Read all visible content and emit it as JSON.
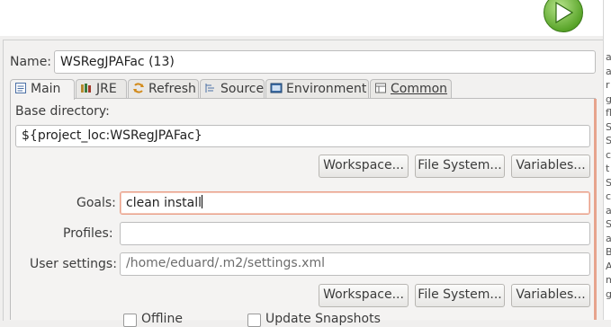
{
  "toolbar": {
    "run_icon": "play-icon"
  },
  "doc_margin": [
    "a",
    "a",
    "r",
    "g",
    "fl",
    "S",
    "S",
    "c",
    "t",
    "S",
    "c",
    "a",
    "S",
    "a",
    "B",
    "A",
    "m",
    "g"
  ],
  "dialog": {
    "name_label": "Name:",
    "name_value": "WSRegJPAFac (13)",
    "tabs": [
      {
        "label": "Main",
        "icon": "main-tab-icon"
      },
      {
        "label": "JRE",
        "icon": "jre-icon"
      },
      {
        "label": "Refresh",
        "icon": "refresh-icon"
      },
      {
        "label": "Source",
        "icon": "source-icon"
      },
      {
        "label": "Environment",
        "icon": "environment-icon"
      },
      {
        "label": "Common",
        "icon": "common-icon"
      }
    ],
    "main": {
      "base_dir_label": "Base directory:",
      "base_dir_value": "${project_loc:WSRegJPAFac}",
      "buttons1": [
        "Workspace...",
        "File System...",
        "Variables..."
      ],
      "goals_label": "Goals:",
      "goals_value": "clean install",
      "profiles_label": "Profiles:",
      "profiles_value": "",
      "user_settings_label": "User settings:",
      "user_settings_placeholder": "/home/eduard/.m2/settings.xml",
      "buttons2": [
        "Workspace...",
        "File System...",
        "Variables..."
      ],
      "offline_label": "Offline",
      "update_snapshots_label": "Update Snapshots"
    }
  },
  "colors": {
    "focus_border": "#e9a08a",
    "run_green": "#5aa52a"
  }
}
